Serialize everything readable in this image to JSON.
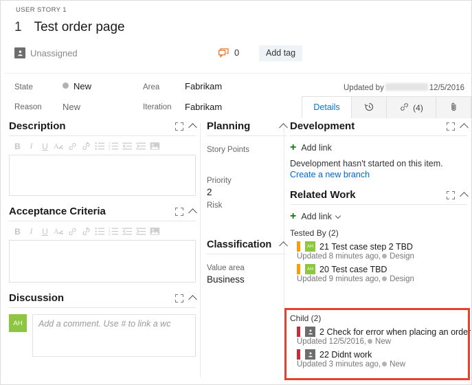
{
  "header": {
    "work_item_type": "USER STORY 1",
    "id": "1",
    "title": "Test order page",
    "assigned_to": "Unassigned",
    "comment_count": "0",
    "add_tag_label": "Add tag"
  },
  "fields": {
    "state_label": "State",
    "state_value": "New",
    "reason_label": "Reason",
    "reason_value": "New",
    "area_label": "Area",
    "area_value": "Fabrikam",
    "iteration_label": "Iteration",
    "iteration_value": "Fabrikam",
    "updated_by_prefix": "Updated by",
    "updated_date": "12/5/2016"
  },
  "tabs": [
    {
      "label": "Details",
      "active": true
    },
    {
      "label": "",
      "icon": "history-icon",
      "active": false
    },
    {
      "label": "(4)",
      "icon": "link-icon",
      "active": false
    },
    {
      "label": "",
      "icon": "attachment-icon",
      "active": false
    }
  ],
  "description": {
    "title": "Description",
    "toolbar": [
      "B",
      "I",
      "U",
      "clear-format",
      "link",
      "unlink",
      "bullet-list",
      "numbered-list",
      "outdent",
      "indent",
      "image"
    ]
  },
  "acceptance_criteria": {
    "title": "Acceptance Criteria"
  },
  "discussion": {
    "title": "Discussion",
    "avatar_initials": "AH",
    "placeholder": "Add a comment. Use # to link a wc"
  },
  "planning": {
    "title": "Planning",
    "fields": [
      {
        "label": "Story Points",
        "value": ""
      },
      {
        "label": "Priority",
        "value": "2"
      },
      {
        "label": "Risk",
        "value": ""
      }
    ]
  },
  "classification": {
    "title": "Classification",
    "fields": [
      {
        "label": "Value area",
        "value": "Business"
      }
    ]
  },
  "development": {
    "title": "Development",
    "add_link_label": "Add link",
    "note": "Development hasn't started on this item.",
    "branch_link": "Create a new branch"
  },
  "related_work": {
    "title": "Related Work",
    "add_link_label": "Add link",
    "groups": [
      {
        "name": "Tested By (2)",
        "items": [
          {
            "bar_color": "#ff9d00",
            "icon": "test-case-icon",
            "icon_initials": "AH",
            "id": "21",
            "title": "Test case step 2 TBD",
            "updated": "Updated 8 minutes ago,",
            "state": "Design"
          },
          {
            "bar_color": "#ff9d00",
            "icon": "test-case-icon",
            "icon_initials": "AH",
            "id": "20",
            "title": "Test case TBD",
            "updated": "Updated 9 minutes ago,",
            "state": "Design"
          }
        ]
      },
      {
        "name": "Child (2)",
        "highlighted": true,
        "items": [
          {
            "bar_color": "#cc293d",
            "icon": "bug-icon",
            "id": "2",
            "title": "Check for error when placing an order",
            "updated": "Updated 12/5/2016,",
            "state": "New"
          },
          {
            "bar_color": "#cc293d",
            "icon": "bug-icon",
            "id": "22",
            "title": "Didnt work",
            "updated": "Updated 3 minutes ago,",
            "state": "New"
          }
        ]
      }
    ]
  },
  "colors": {
    "accent": "#1ba1e2",
    "highlight_border": "#e8402a",
    "link": "#0066cc",
    "tab_active": "#0078d4",
    "green": "#107c10",
    "avatar_green": "#8dc63f",
    "orange": "#ff9d00",
    "red": "#cc293d"
  }
}
